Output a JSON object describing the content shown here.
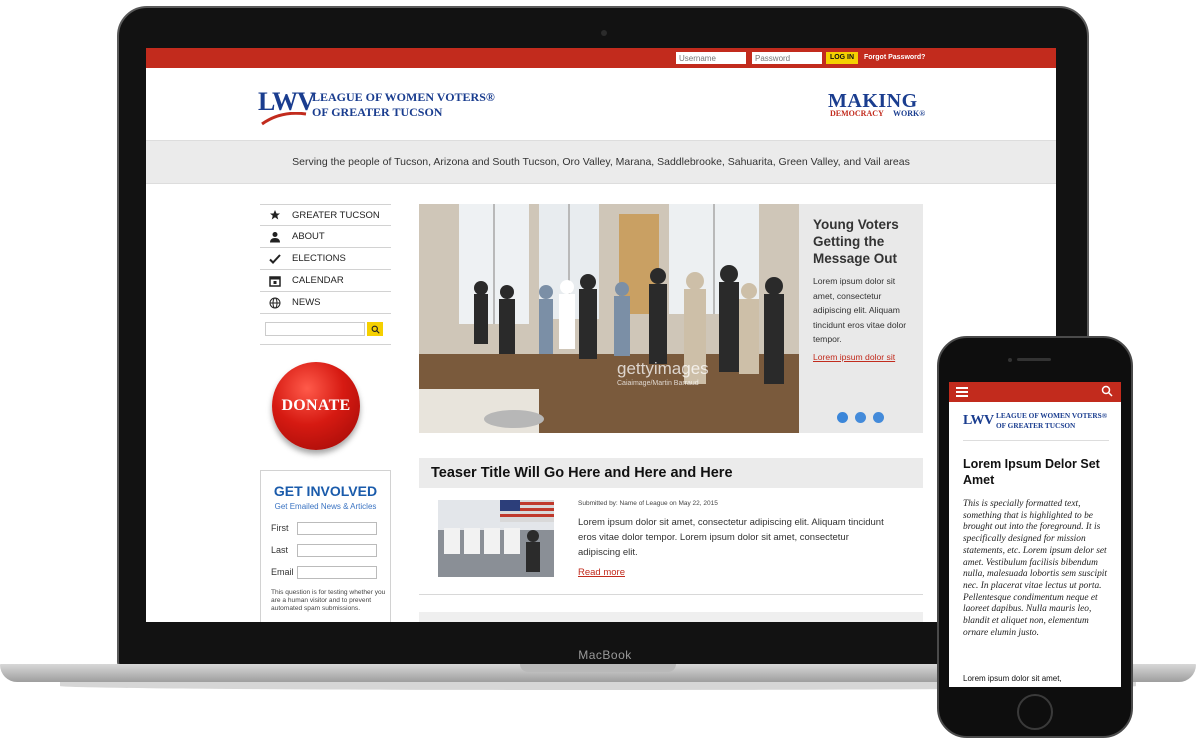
{
  "colors": {
    "brand_red": "#c22b1d",
    "brand_blue": "#1a3d8f",
    "link_blue": "#1a5bab",
    "accent_yellow": "#f5d000",
    "panel_gray": "#e9e9e9",
    "dot_blue": "#3b86d9"
  },
  "device": {
    "laptop_label": "MacBook"
  },
  "login": {
    "username_placeholder": "Username",
    "password_placeholder": "Password",
    "login_label": "LOG IN",
    "forgot_label": "Forgot Password?"
  },
  "header": {
    "logo_mark": "LWV",
    "logo_line1": "LEAGUE OF WOMEN VOTERS®",
    "logo_line2": "OF GREATER TUCSON",
    "mdw_title": "MAKING",
    "mdw_sub1": "DEMOCRACY",
    "mdw_sub2": "WORK®"
  },
  "tagline": "Serving the people of Tucson, Arizona and South Tucson, Oro Valley, Marana, Saddlebrooke, Sahuarita, Green Valley, and Vail areas",
  "nav": {
    "items": [
      {
        "label": "GREATER TUCSON",
        "icon": "star-icon"
      },
      {
        "label": "ABOUT",
        "icon": "person-icon"
      },
      {
        "label": "ELECTIONS",
        "icon": "checkmark-icon"
      },
      {
        "label": "CALENDAR",
        "icon": "calendar-icon"
      },
      {
        "label": "NEWS",
        "icon": "globe-icon"
      }
    ],
    "search_icon": "search-icon"
  },
  "donate": {
    "label": "DONATE"
  },
  "involved": {
    "title": "GET INVOLVED",
    "subtitle": "Get Emailed News & Articles",
    "fields": [
      "First",
      "Last",
      "Email"
    ],
    "captcha_note": "This question is for testing whether you are a human visitor and to prevent automated spam submissions."
  },
  "hero": {
    "title": "Young Voters Getting the Message Out",
    "body": "Lorem ipsum dolor sit amet, consectetur adipiscing elit. Aliquam tincidunt eros vitae dolor tempor.",
    "link": "Lorem ipsum dolor sit",
    "watermark": "gettyimages",
    "watermark_credit": "Caiaimage/Martin Barraud",
    "slides": 3,
    "active_slide": 1
  },
  "teaser": {
    "title": "Teaser Title Will Go Here and Here and Here",
    "meta": "Submitted by: Name of League on May 22, 2015",
    "body": "Lorem ipsum dolor sit amet, consectetur adipiscing elit. Aliquam tincidunt eros vitae dolor tempor. Lorem ipsum dolor sit amet, consectetur adipiscing elit.",
    "read_more": "Read more"
  },
  "phone": {
    "logo_mark": "LWV",
    "logo_line1": "LEAGUE OF WOMEN VOTERS®",
    "logo_line2": "OF GREATER TUCSON",
    "title": "Lorem Ipsum Delor Set Amet",
    "body": "This is specially formatted text, something that is highlighted to be brought out into the foreground. It is specifically designed for mission statements, etc. Lorem ipsum delor set amet. Vestibulum facilisis bibendum nulla, malesuada lobortis sem suscipit nec. In placerat vitae lectus ut porta. Pellentesque condimentum neque et laoreet dapibus. Nulla mauris leo, blandit et aliquet non, elementum ornare elumin justo.",
    "footer_text": "Lorem ipsum dolor sit amet,"
  }
}
